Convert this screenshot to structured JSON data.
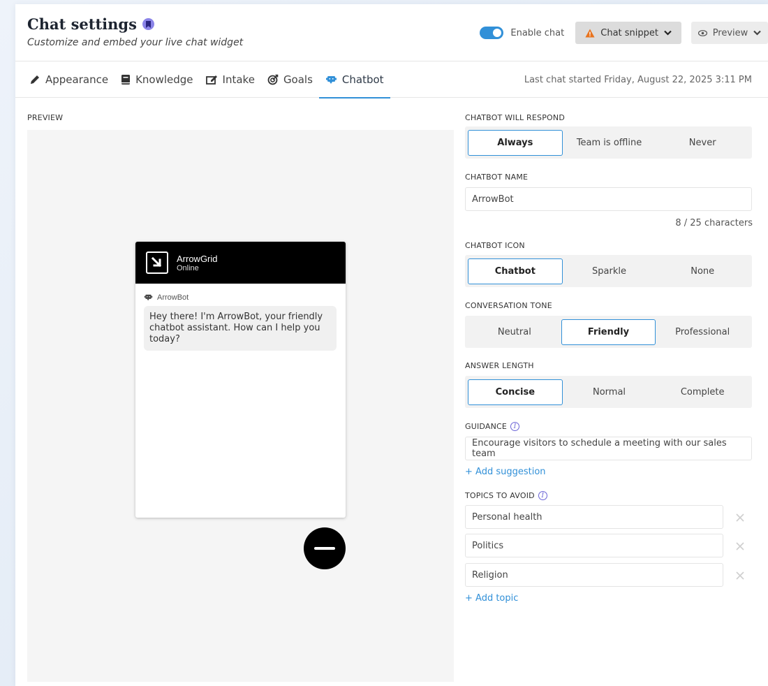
{
  "header": {
    "title": "Chat settings",
    "subtitle": "Customize and embed your live chat widget",
    "enable_chat_label": "Enable chat",
    "chat_snippet_label": "Chat snippet",
    "preview_label": "Preview"
  },
  "tabs": [
    {
      "label": "Appearance",
      "icon": "pencil-icon"
    },
    {
      "label": "Knowledge",
      "icon": "book-icon"
    },
    {
      "label": "Intake",
      "icon": "edit-form-icon"
    },
    {
      "label": "Goals",
      "icon": "target-icon"
    },
    {
      "label": "Chatbot",
      "icon": "chatbot-icon",
      "active": true
    }
  ],
  "last_chat": "Last chat started Friday, August 22, 2025 3:11 PM",
  "preview": {
    "label": "PREVIEW",
    "widget_name": "ArrowGrid",
    "widget_status": "Online",
    "bot_name": "ArrowBot",
    "message": "Hey there! I'm ArrowBot, your friendly chatbot assistant. How can I help you today?"
  },
  "settings": {
    "respond": {
      "label": "CHATBOT WILL RESPOND",
      "options": [
        "Always",
        "Team is offline",
        "Never"
      ],
      "selected": "Always"
    },
    "name": {
      "label": "CHATBOT NAME",
      "value": "ArrowBot",
      "count": "8 / 25 characters"
    },
    "icon": {
      "label": "CHATBOT ICON",
      "options": [
        "Chatbot",
        "Sparkle",
        "None"
      ],
      "selected": "Chatbot"
    },
    "tone": {
      "label": "CONVERSATION TONE",
      "options": [
        "Neutral",
        "Friendly",
        "Professional"
      ],
      "selected": "Friendly"
    },
    "length": {
      "label": "ANSWER LENGTH",
      "options": [
        "Concise",
        "Normal",
        "Complete"
      ],
      "selected": "Concise"
    },
    "guidance": {
      "label": "GUIDANCE",
      "value": "Encourage visitors to schedule a meeting with our sales team",
      "add_label": "+ Add suggestion"
    },
    "topics": {
      "label": "TOPICS TO AVOID",
      "items": [
        "Personal health",
        "Politics",
        "Religion"
      ],
      "add_label": "+ Add topic"
    }
  },
  "colors": {
    "accent": "#3190d8",
    "warning": "#e8731e",
    "badge": "#8b84e8"
  }
}
